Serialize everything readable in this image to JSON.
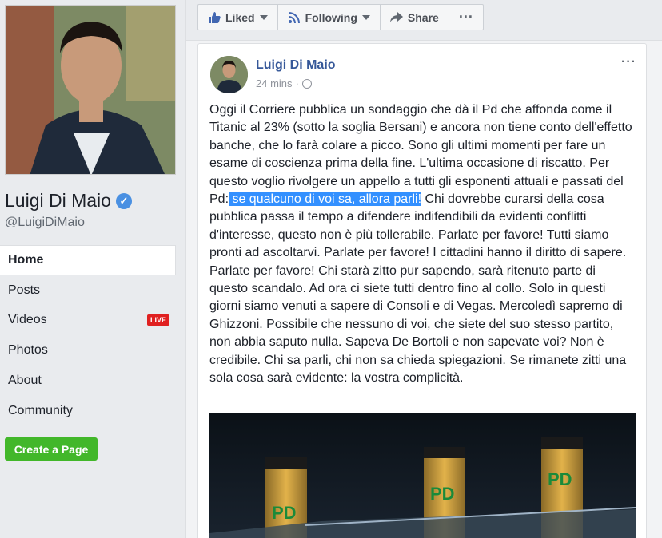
{
  "profile": {
    "name": "Luigi Di Maio",
    "handle": "@LuigiDiMaio",
    "verified_icon": "check-icon"
  },
  "nav": {
    "items": [
      {
        "label": "Home",
        "active": true
      },
      {
        "label": "Posts"
      },
      {
        "label": "Videos",
        "badge": "LIVE"
      },
      {
        "label": "Photos"
      },
      {
        "label": "About"
      },
      {
        "label": "Community"
      }
    ]
  },
  "create_page_label": "Create a Page",
  "actionbar": {
    "liked": "Liked",
    "following": "Following",
    "share": "Share",
    "more": "···"
  },
  "post": {
    "author": "Luigi Di Maio",
    "time": "24 mins",
    "separator": "·",
    "more": "···",
    "text_before": "Oggi il Corriere pubblica un sondaggio che dà il Pd che affonda come il Titanic al 23% (sotto la soglia Bersani) e ancora non tiene conto dell'effetto banche, che lo farà colare a picco. Sono gli ultimi momenti per fare un esame di coscienza prima della fine. L'ultima occasione di riscatto. Per questo voglio rivolgere un appello a tutti gli esponenti attuali e passati del Pd:",
    "text_highlight": " se qualcuno di voi sa, allora parli!",
    "text_after": " Chi dovrebbe curarsi della cosa pubblica passa il tempo a difendere indifendibili da evidenti conflitti d'interesse, questo non è più tollerabile. Parlate per favore! Tutti siamo pronti ad ascoltarvi. Parlate per favore! I cittadini hanno il diritto di sapere. Parlate per favore! Chi starà zitto pur sapendo, sarà ritenuto parte di questo scandalo. Ad ora ci siete tutti dentro fino al collo. Solo in questi giorni siamo venuti a sapere di Consoli e di Vegas. Mercoledì sapremo di Ghizzoni. Possibile che nessuno di voi, che siete del suo stesso partito, non abbia saputo nulla. Sapeva De Bortoli e non sapevate voi? Non è credibile. Chi sa parli, chi non sa chieda spiegazioni. Se rimanete zitti una sola cosa sarà evidente: la vostra complicità.",
    "image_logo_text": "PD"
  },
  "colors": {
    "link": "#365899",
    "highlight": "#3390ff",
    "green_button": "#42b72a",
    "live": "#e02020"
  }
}
